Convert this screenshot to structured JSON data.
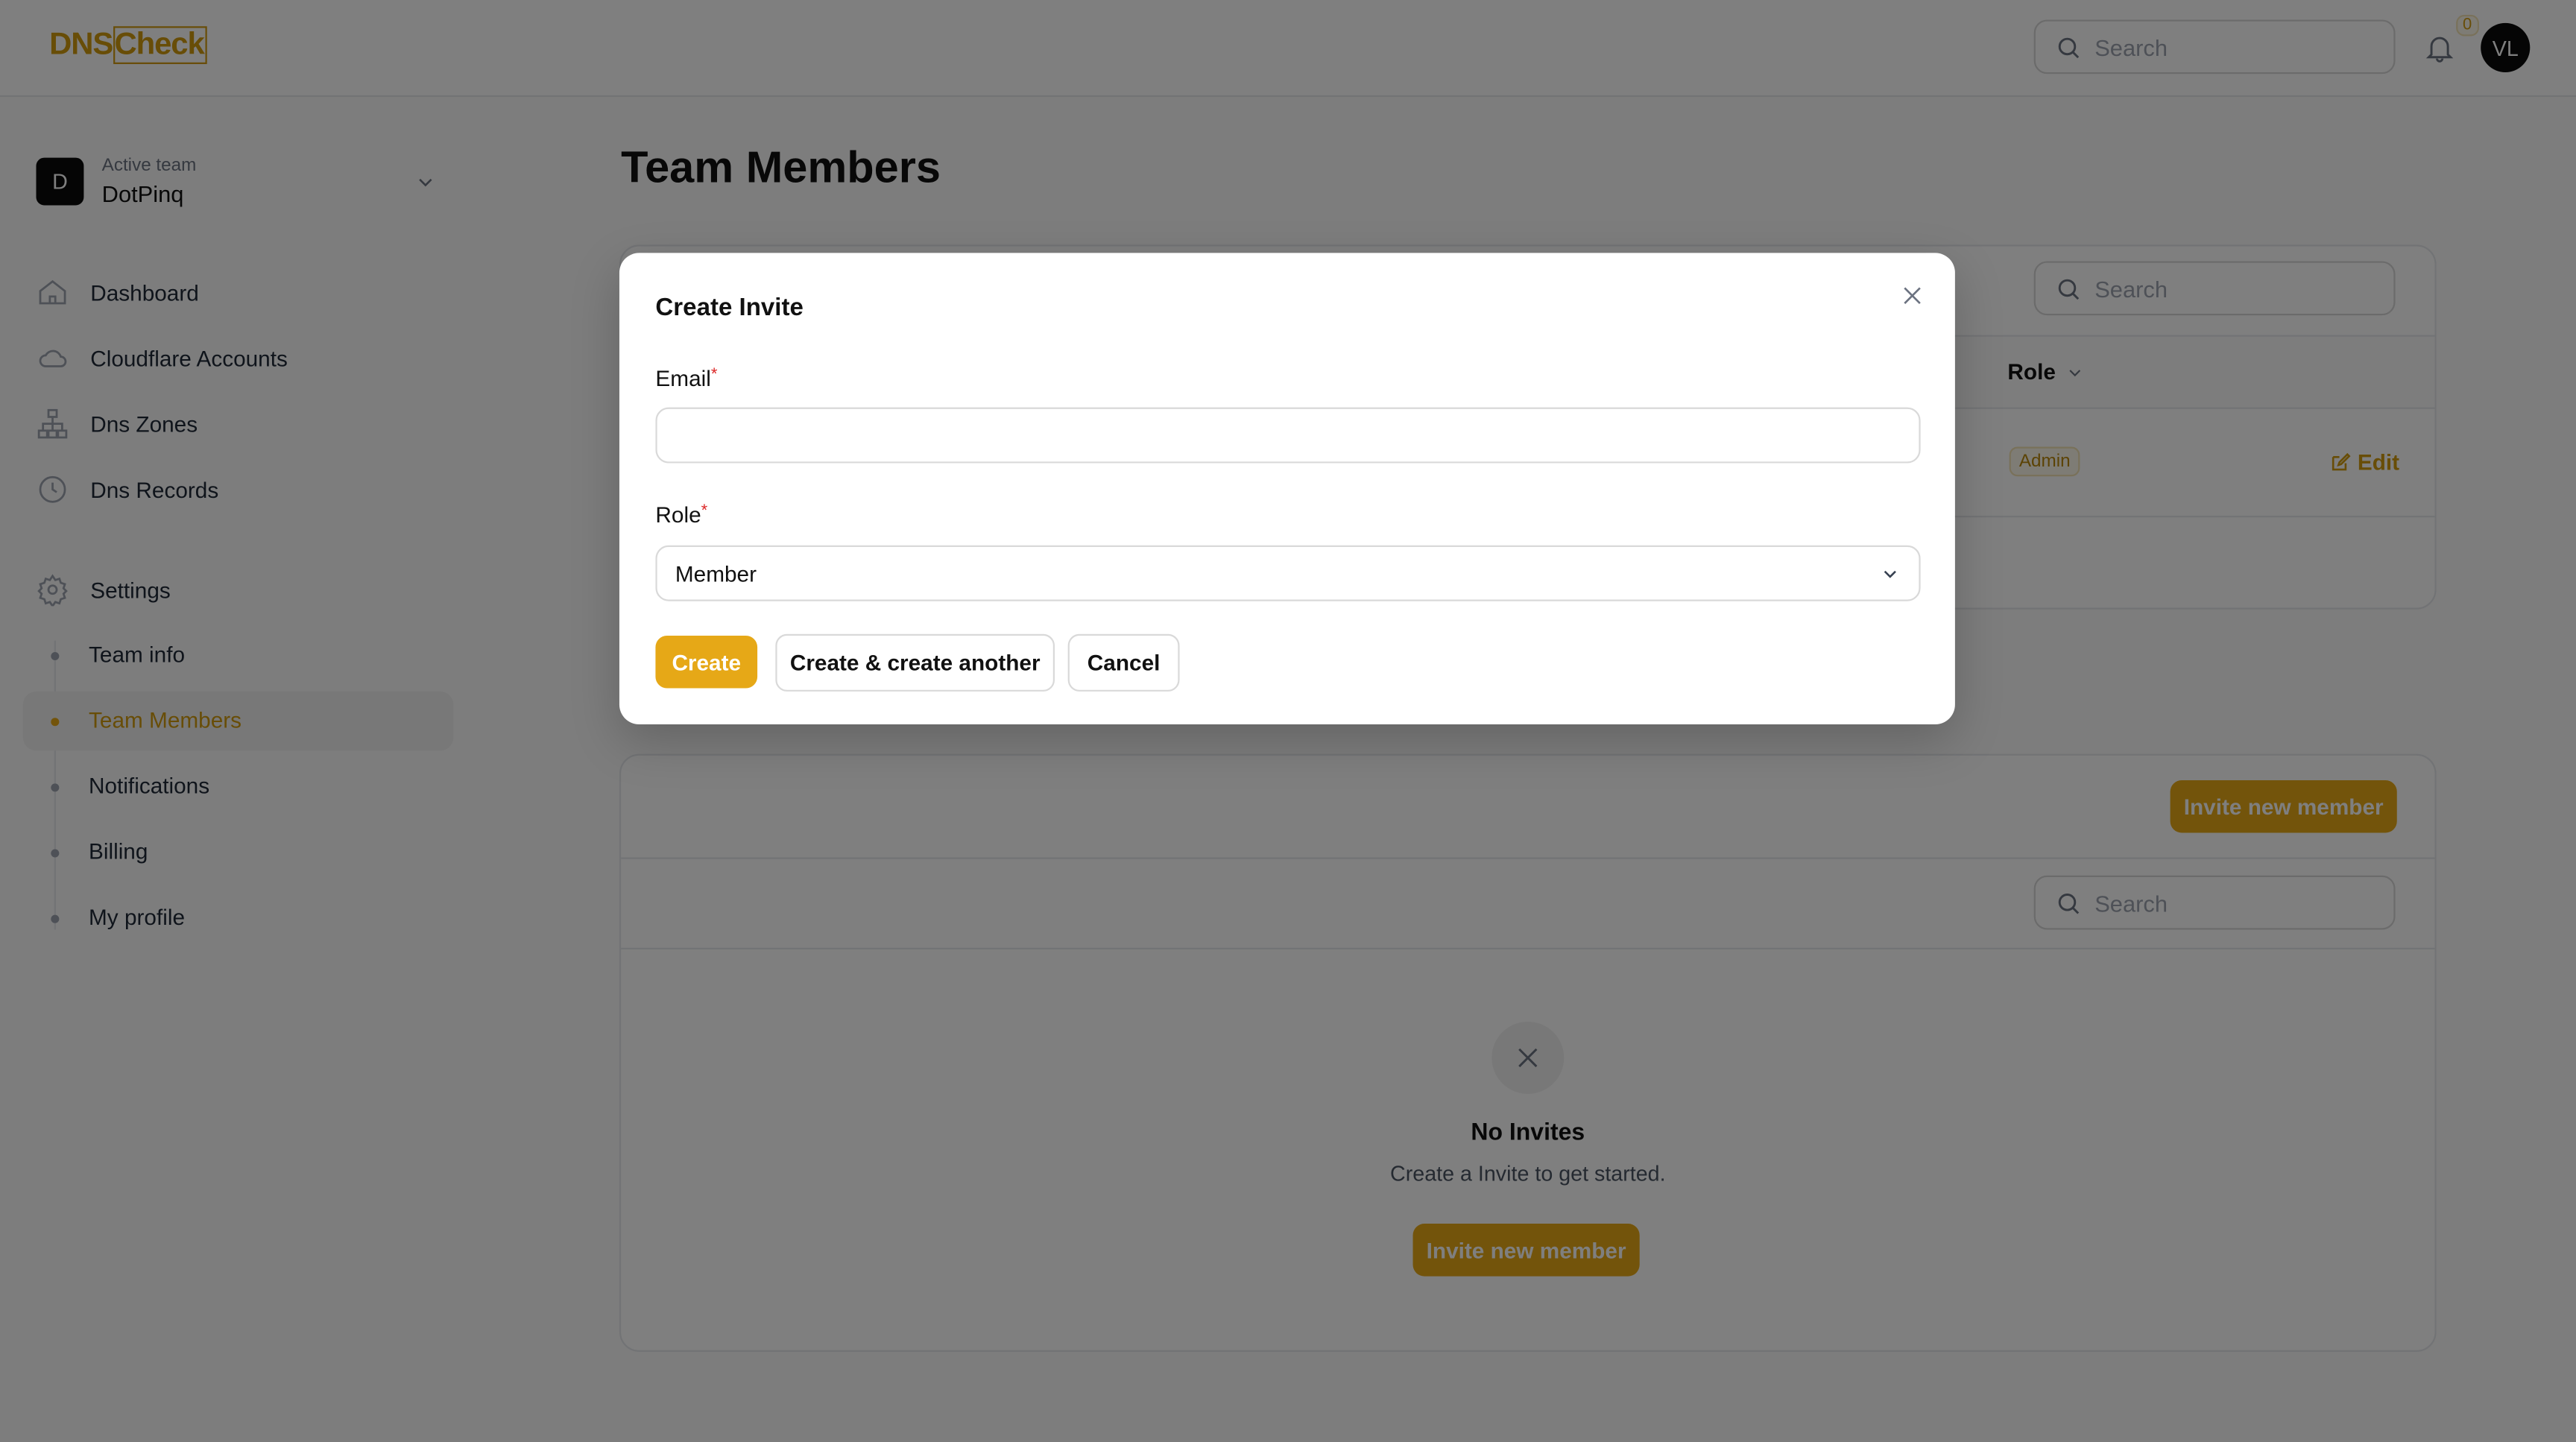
{
  "header": {
    "logo_text": "DNSCheck",
    "logo_part1": "DNS",
    "logo_part2": "Check",
    "search_placeholder": "Search",
    "notification_count": "0",
    "avatar_initials": "VL"
  },
  "sidebar": {
    "team_label": "Active team",
    "team_name": "DotPinq",
    "team_initial": "D",
    "items": [
      {
        "label": "Dashboard",
        "icon": "home-icon"
      },
      {
        "label": "Cloudflare Accounts",
        "icon": "cloud-icon"
      },
      {
        "label": "Dns Zones",
        "icon": "sitemap-icon"
      },
      {
        "label": "Dns Records",
        "icon": "clock-icon"
      },
      {
        "label": "Settings",
        "icon": "gear-icon"
      }
    ],
    "settings_items": [
      {
        "label": "Team info"
      },
      {
        "label": "Team Members",
        "active": true
      },
      {
        "label": "Notifications"
      },
      {
        "label": "Billing"
      },
      {
        "label": "My profile"
      }
    ]
  },
  "main": {
    "title": "Team Members",
    "members_table": {
      "search_placeholder": "Search",
      "columns": [
        "Role"
      ],
      "rows": [
        {
          "role": "Admin",
          "action": "Edit"
        }
      ]
    },
    "invites": {
      "invite_button": "Invite new member",
      "search_placeholder": "Search",
      "empty_title": "No Invites",
      "empty_text": "Create a Invite to get started.",
      "empty_button": "Invite new member"
    }
  },
  "modal": {
    "title": "Create Invite",
    "email_label": "Email",
    "email_value": "",
    "role_label": "Role",
    "role_value": "Member",
    "required_mark": "*",
    "create": "Create",
    "create_another": "Create & create another",
    "cancel": "Cancel"
  },
  "colors": {
    "accent": "#e6a817",
    "overlay": "rgba(0,0,0,0.5)"
  }
}
